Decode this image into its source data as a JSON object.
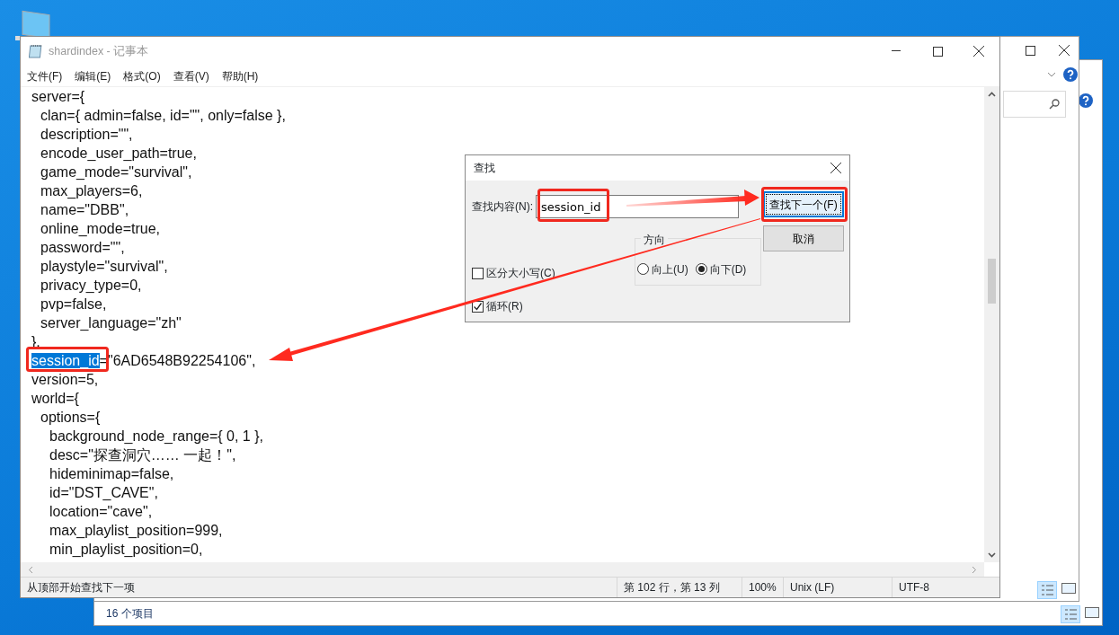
{
  "explorer_window": {
    "status_text": "16 个项目"
  },
  "notepad": {
    "title": "shardindex - 记事本",
    "menu": [
      "文件(F)",
      "编辑(E)",
      "格式(O)",
      "查看(V)",
      "帮助(H)"
    ],
    "lines": [
      {
        "text": "server={",
        "children": [
          {
            "text": "clan={ admin=false, id=\"\", only=false },"
          },
          {
            "text": "description=\"\","
          },
          {
            "text": "encode_user_path=true,"
          },
          {
            "text": "game_mode=\"survival\","
          },
          {
            "text": "max_players=6,"
          },
          {
            "text": "name=\"DBB\","
          },
          {
            "text": "online_mode=true,"
          },
          {
            "text": "password=\"\","
          },
          {
            "text": "playstyle=\"survival\","
          },
          {
            "text": "privacy_type=0,"
          },
          {
            "text": "pvp=false,"
          },
          {
            "text": "server_language=\"zh\""
          }
        ]
      },
      {
        "text": "},"
      },
      {
        "segments": [
          {
            "text": "session_id",
            "selected": true
          },
          {
            "text": "=\"6AD6548B92254106\",",
            "selected": false
          }
        ]
      },
      {
        "text": "version=5,"
      },
      {
        "text": "world={",
        "children": [
          {
            "text": "options={",
            "children": [
              {
                "text": "background_node_range={ 0, 1 },"
              },
              {
                "text": "desc=\"探查洞穴…… 一起！\","
              },
              {
                "text": "hideminimap=false,"
              },
              {
                "text": "id=\"DST_CAVE\","
              },
              {
                "text": "location=\"cave\","
              },
              {
                "text": "max_playlist_position=999,"
              },
              {
                "text": "min_playlist_position=0,"
              }
            ]
          }
        ]
      }
    ],
    "status_bar": {
      "message": "从顶部开始查找下一项",
      "position": "第 102 行，第 13 列",
      "zoom": "100%",
      "line_ending": "Unix (LF)",
      "encoding": "UTF-8"
    }
  },
  "find_dialog": {
    "title": "查找",
    "find_label": "查找内容(N):",
    "find_value": "session_id",
    "find_next_button": "查找下一个(F)",
    "cancel_button": "取消",
    "direction_label": "方向",
    "directions": [
      {
        "label": "向上(U)",
        "selected": false
      },
      {
        "label": "向下(D)",
        "selected": true
      }
    ],
    "options": [
      {
        "label": "区分大小写(C)",
        "checked": false
      },
      {
        "label": "循环(R)",
        "checked": true
      }
    ]
  }
}
